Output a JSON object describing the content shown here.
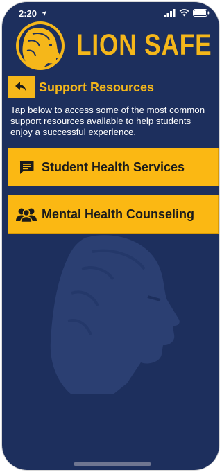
{
  "status_bar": {
    "time": "2:20",
    "location_icon": "location-arrow-icon",
    "wifi_icon": "wifi-icon",
    "battery_icon": "battery-icon"
  },
  "header": {
    "app_title": "LION SAFE",
    "logo_icon": "lion-logo-icon"
  },
  "nav": {
    "back_icon": "back-arrow-icon",
    "section_title": "Support Resources"
  },
  "intro_text": "Tap below to access some of the most common support resources available to help students enjoy a successful experience.",
  "resources": [
    {
      "label": "Student Health Services",
      "icon": "chat-message-icon"
    },
    {
      "label": "Mental Health Counseling",
      "icon": "people-group-icon"
    }
  ],
  "colors": {
    "background": "#1d2f5d",
    "accent": "#f5b71a",
    "button_fill": "#fbb813",
    "text_light": "#ffffff",
    "text_dark": "#1b1b1b"
  }
}
